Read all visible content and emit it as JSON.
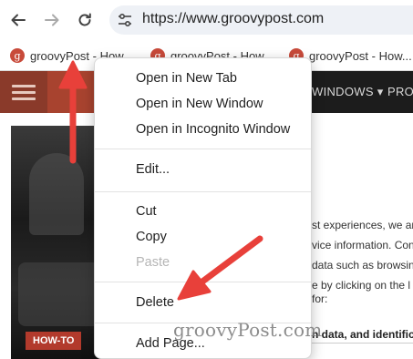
{
  "toolbar": {
    "back_icon": "arrow-left-icon",
    "forward_icon": "arrow-right-icon",
    "reload_icon": "reload-icon",
    "site_info_icon": "tune-icon",
    "url": "https://www.groovypost.com"
  },
  "bookmarks": [
    {
      "label": "groovyPost - How...",
      "favicon": "g"
    },
    {
      "label": "groovyPost - How...",
      "favicon": "g"
    },
    {
      "label": "groovyPost - How...",
      "favicon": "g"
    }
  ],
  "page": {
    "nav": [
      "WINDOWS ▾",
      "PRO"
    ],
    "badge": "HOW-TO",
    "text_lines": [
      "st experiences, we an",
      "vice information. Con",
      "data such as browsin",
      "e by clicking on the l",
      "for:",
      "n data, and identifica"
    ]
  },
  "menu": {
    "items": [
      {
        "label": "Open in New Tab",
        "enabled": true
      },
      {
        "label": "Open in New Window",
        "enabled": true
      },
      {
        "label": "Open in Incognito Window",
        "enabled": true
      },
      {
        "label": "Edit...",
        "enabled": true
      },
      {
        "label": "Cut",
        "enabled": true
      },
      {
        "label": "Copy",
        "enabled": true
      },
      {
        "label": "Paste",
        "enabled": false
      },
      {
        "label": "Delete",
        "enabled": true
      },
      {
        "label": "Add Page...",
        "enabled": true
      }
    ]
  },
  "annotations": {
    "arrow_color": "#e8403a"
  },
  "watermark": "groovyPost.com",
  "colors": {
    "accent": "#a8432f",
    "header_bg": "#1c1c1c",
    "omnibox_bg": "#eef1f6"
  }
}
